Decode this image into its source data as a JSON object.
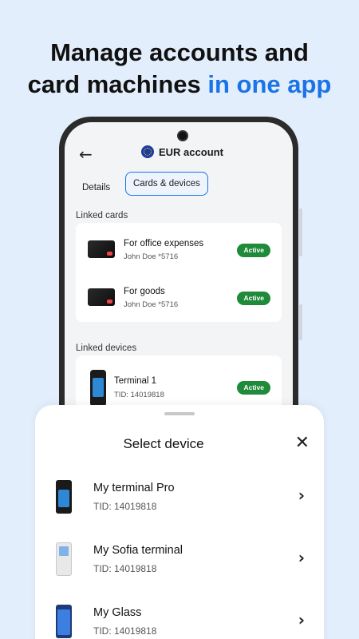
{
  "headline": {
    "line1": "Manage accounts and",
    "line2_plain": "card machines ",
    "line2_accent": "in one app"
  },
  "phone": {
    "account_title": "EUR account",
    "tabs": [
      {
        "label": "Details",
        "active": false
      },
      {
        "label": "Cards & devices",
        "active": true
      }
    ],
    "linked_cards_label": "Linked cards",
    "cards": [
      {
        "title": "For office expenses",
        "subtitle": "John Doe *5716",
        "status": "Active"
      },
      {
        "title": "For goods",
        "subtitle": "John Doe *5716",
        "status": "Active"
      }
    ],
    "linked_devices_label": "Linked devices",
    "devices": [
      {
        "title": "Terminal 1",
        "subtitle": "TID: 14019818",
        "status": "Active"
      }
    ]
  },
  "sheet": {
    "title": "Select device",
    "devices": [
      {
        "name": "My terminal Pro",
        "tid": "TID: 14019818"
      },
      {
        "name": "My Sofia terminal",
        "tid": "TID: 14019818"
      },
      {
        "name": "My Glass",
        "tid": "TID: 14019818"
      }
    ]
  },
  "colors": {
    "background": "#e3eefc",
    "accent": "#1a73e8",
    "active_badge": "#1f8a3a"
  }
}
